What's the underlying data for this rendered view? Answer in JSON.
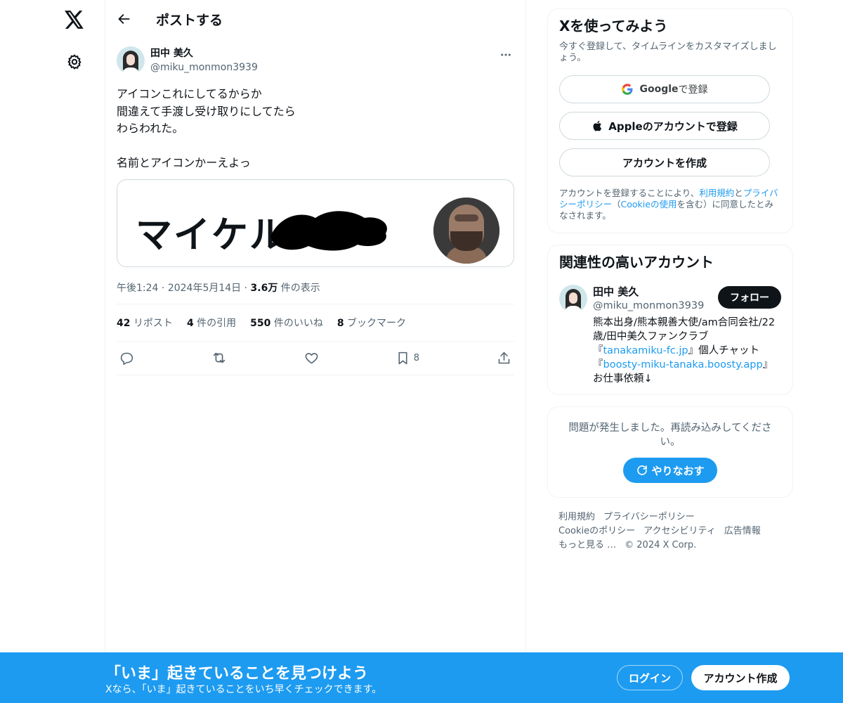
{
  "nav": {
    "logo_icon": "x-logo-icon",
    "settings_icon": "gear-icon"
  },
  "header": {
    "title": "ポストする"
  },
  "post": {
    "author_name": "田中 美久",
    "author_handle": "@miku_monmon3939",
    "text": "アイコンこれにしてるからか\n間違えて手渡し受け取りにしてたら\nわらわれた。\n\n名前とアイコンかーえよっ",
    "card_text": "マイケル",
    "time": "午後1:24",
    "date": "2024年5月14日",
    "views_count": "3.6万",
    "views_label": "件の表示",
    "stats": [
      {
        "count": "42",
        "label": "リポスト"
      },
      {
        "count": "4",
        "label": "件の引用"
      },
      {
        "count": "550",
        "label": "件のいいね"
      },
      {
        "count": "8",
        "label": "ブックマーク"
      }
    ],
    "bookmark_count": "8"
  },
  "signup": {
    "title": "Xを使ってみよう",
    "subtitle": "今すぐ登録して、タイムラインをカスタマイズしましょう。",
    "google_brand": "Google",
    "google_label": " で登録",
    "apple_label": "Appleのアカウントで登録",
    "create_label": "アカウントを作成",
    "terms_pre": "アカウントを登録することにより、",
    "terms_link1": "利用規約",
    "terms_mid1": "と",
    "terms_link2": "プライバシーポリシー",
    "terms_mid2": "（",
    "terms_link3": "Cookieの使用",
    "terms_post": "を含む）に同意したとみなされます。"
  },
  "related": {
    "title": "関連性の高いアカウント",
    "name": "田中 美久",
    "handle": "@miku_monmon3939",
    "follow_label": "フォロー",
    "bio_1": "熊本出身/熊本親善大使/am合同会社/22歳/田中美久ファンクラブ『",
    "bio_link1": "tanakamiku-fc.jp",
    "bio_2": "』個人チャット『",
    "bio_link2": "boosty-miku-tanaka.boosty.app",
    "bio_3": "』お仕事依頼↓"
  },
  "error": {
    "text": "問題が発生しました。再読み込みしてください。",
    "retry_label": "やりなおす"
  },
  "footer": {
    "links": [
      "利用規約",
      "プライバシーポリシー",
      "Cookieのポリシー",
      "アクセシビリティ",
      "広告情報",
      "もっと見る …"
    ],
    "copyright": "© 2024 X Corp."
  },
  "bottom_bar": {
    "title": "「いま」起きていることを見つけよう",
    "subtitle": "Xなら、「いま」起きていることをいち早くチェックできます。",
    "login_label": "ログイン",
    "signup_label": "アカウント作成"
  },
  "colors": {
    "accent": "#1d9bf0",
    "text": "#0f1419",
    "muted": "#536471"
  }
}
